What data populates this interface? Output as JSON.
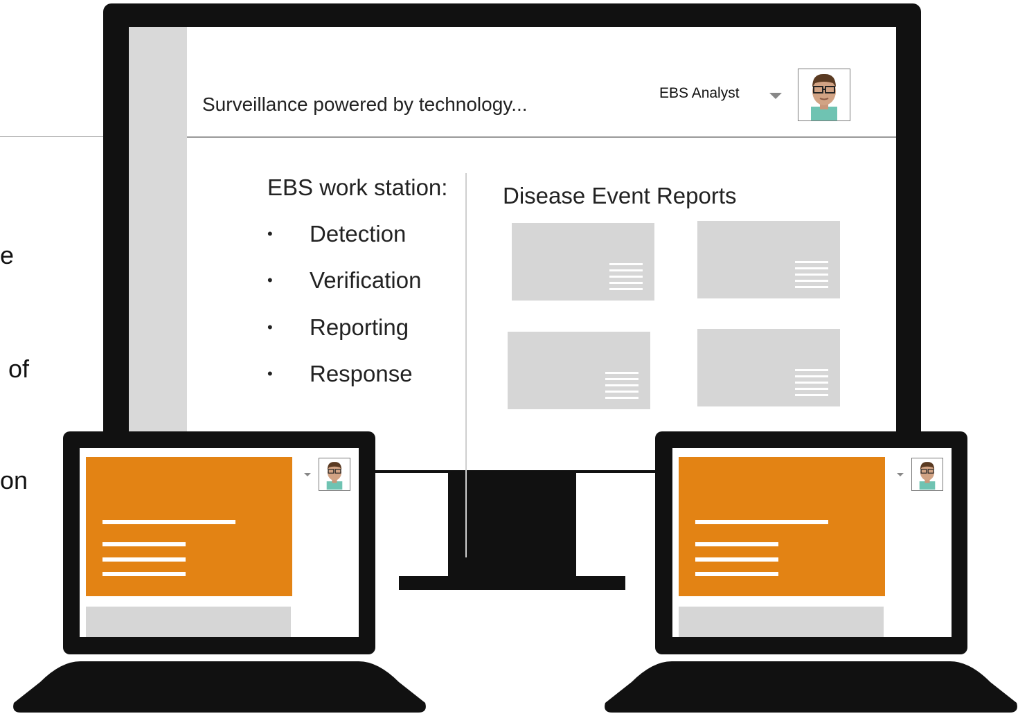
{
  "left_fragments": [
    "e",
    "of",
    "on"
  ],
  "monitor": {
    "tagline": "Surveillance powered by technology...",
    "user_name": "EBS Analyst",
    "user_avatar_icon": "analyst-avatar-icon",
    "dropdown_icon": "caret-down-icon",
    "workstation": {
      "title": "EBS work station:",
      "items": [
        "Detection",
        "Verification",
        "Reporting",
        "Response"
      ]
    },
    "reports": {
      "title": "Disease Event Reports",
      "card_count_label": ""
    }
  },
  "colors": {
    "bezel": "#111111",
    "accent_orange": "#e38314",
    "placeholder_gray": "#d6d6d6"
  }
}
